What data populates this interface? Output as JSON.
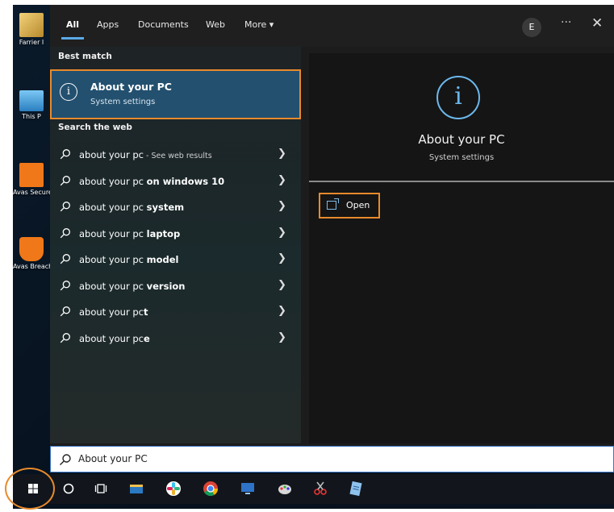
{
  "desktop": {
    "icons": [
      {
        "label": "Farrier I",
        "icon": "user-folder-icon",
        "color": "#e0b050"
      },
      {
        "label": "This P",
        "icon": "computer-icon",
        "color": "#4aa3df"
      },
      {
        "label": "Avas Secure",
        "icon": "avast-vpn-icon",
        "color": "#f07818"
      },
      {
        "label": "Avas BreachG",
        "icon": "avast-breach-icon",
        "color": "#f07818"
      }
    ]
  },
  "tabs": [
    {
      "label": "All",
      "active": true
    },
    {
      "label": "Apps"
    },
    {
      "label": "Documents"
    },
    {
      "label": "Web"
    },
    {
      "label": "More ▾"
    }
  ],
  "header": {
    "avatar_initial": "E",
    "more_glyph": "···",
    "close_glyph": "✕"
  },
  "best_match": {
    "heading": "Best match",
    "title": "About your PC",
    "subtitle": "System settings"
  },
  "web": {
    "heading": "Search the web",
    "items": [
      {
        "prefix": "about your pc",
        "bold": "",
        "sub": " - See web results"
      },
      {
        "prefix": "about your pc ",
        "bold": "on windows 10",
        "sub": ""
      },
      {
        "prefix": "about your pc ",
        "bold": "system",
        "sub": ""
      },
      {
        "prefix": "about your pc ",
        "bold": "laptop",
        "sub": ""
      },
      {
        "prefix": "about your pc ",
        "bold": "model",
        "sub": ""
      },
      {
        "prefix": "about your pc ",
        "bold": "version",
        "sub": ""
      },
      {
        "prefix": "about your pc",
        "bold": "t",
        "sub": ""
      },
      {
        "prefix": "about your pc",
        "bold": "e",
        "sub": ""
      }
    ]
  },
  "preview": {
    "title": "About your PC",
    "subtitle": "System settings",
    "open_label": "Open"
  },
  "search": {
    "value": "About your PC"
  },
  "colors": {
    "highlight": "#e88a2b",
    "accent": "#5aa9e6",
    "selected": "#23506f"
  }
}
